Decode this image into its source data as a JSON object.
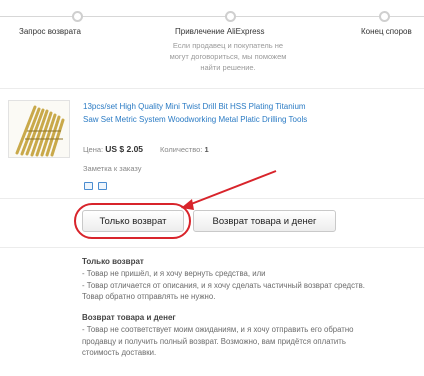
{
  "steps": [
    {
      "label": "Запрос возврата"
    },
    {
      "label": "Привлечение AliExpress"
    },
    {
      "label": "Конец споров"
    }
  ],
  "step_description": "Если продавец и покупатель не могут договориться, мы поможем найти решение.",
  "product": {
    "title": "13pcs/set High Quality Mini Twist Drill Bit HSS Plating Titanium Saw Set Metric System Woodworking Metal Platic Drilling Tools",
    "price_label": "Цена:",
    "price_value": "US $ 2.05",
    "qty_label": "Количество:",
    "qty_value": "1",
    "note_label": "Заметка к заказу"
  },
  "buttons": {
    "refund_only": "Только возврат",
    "return_and_refund": "Возврат товара и денег"
  },
  "colors": {
    "link": "#2b7bc4",
    "highlight": "#d8242b"
  },
  "info": {
    "refund_title": "Только возврат",
    "refund_lines": [
      "- Товар не пришёл, и я хочу вернуть средства, или",
      "- Товар отличается от описания, и я хочу сделать частичный возврат средств. Товар обратно отправлять не нужно."
    ],
    "return_title": "Возврат товара и денег",
    "return_lines": [
      "- Товар не соответствует моим ожиданиям, и я хочу отправить его обратно продавцу и получить полный возврат. Возможно, вам придётся оплатить стоимость доставки."
    ]
  }
}
